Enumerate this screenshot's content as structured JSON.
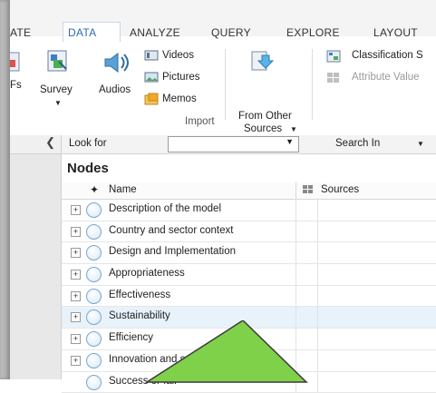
{
  "tabs": [
    "ATE",
    "DATA",
    "ANALYZE",
    "QUERY",
    "EXPLORE",
    "LAYOUT"
  ],
  "active_tab": "DATA",
  "ribbon": {
    "fs_label": "Fs",
    "survey_label": "Survey",
    "audios_label": "Audios",
    "videos_label": "Videos",
    "pictures_label": "Pictures",
    "memos_label": "Memos",
    "from_other_line1": "From Other",
    "from_other_line2": "Sources",
    "classification_label": "Classification S",
    "attribute_label": "Attribute Value",
    "group_import": "Import"
  },
  "findbar": {
    "look_for": "Look for",
    "search_in": "Search In"
  },
  "nodes": {
    "title": "Nodes",
    "col_name": "Name",
    "col_sources": "Sources",
    "items": [
      "Description of the model",
      "Country and sector context",
      "Design and Implementation",
      "Appropriateness",
      "Effectiveness",
      "Sustainability",
      "Efficiency",
      "Innovation and sc",
      "Success or fail"
    ],
    "selected_index": 5
  },
  "colors": {
    "accent": "#2a6ab3",
    "arrow_fill": "#7fd14a",
    "arrow_stroke": "#3a3a3a",
    "selected_row": "#e8f2fb"
  }
}
